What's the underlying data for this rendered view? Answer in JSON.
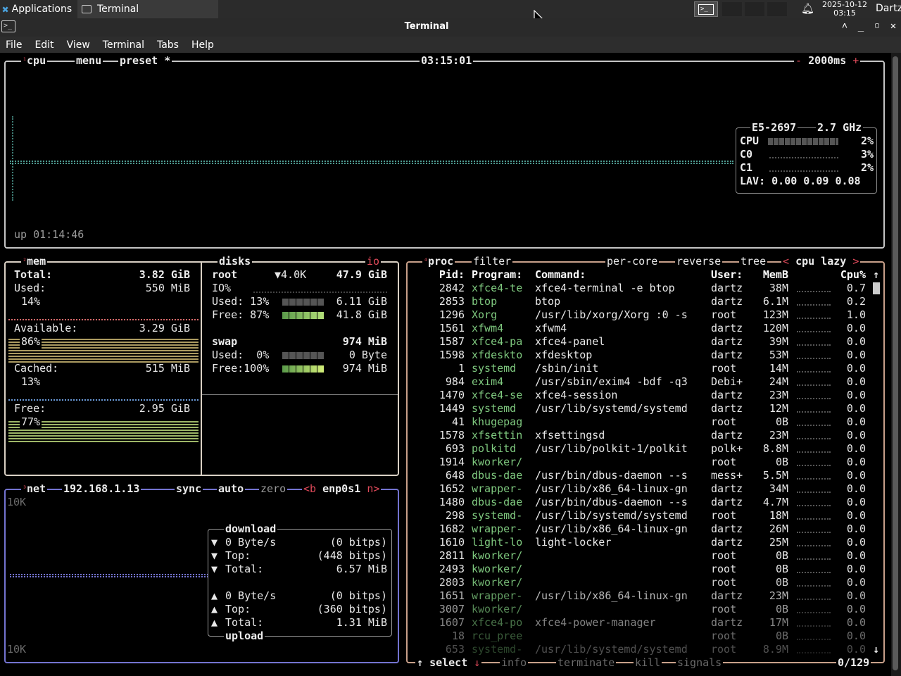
{
  "panel": {
    "apps_label": "Applications",
    "task_title": "Terminal",
    "clock_date": "2025-10-12",
    "clock_time": "03:15",
    "user": "Dartz"
  },
  "window": {
    "title": "Terminal",
    "menu": [
      "File",
      "Edit",
      "View",
      "Terminal",
      "Tabs",
      "Help"
    ]
  },
  "cpu_box": {
    "num": "¹",
    "title": "cpu",
    "menu": "menu",
    "preset": "preset *",
    "clock": "03:15:01",
    "minus": "-",
    "interval": "2000ms",
    "plus": "+",
    "uptime": "up 01:14:46",
    "model": "E5-2697",
    "freq": "2.7 GHz",
    "rows": [
      {
        "label": "CPU",
        "value": "2%"
      },
      {
        "label": "C0",
        "value": "3%"
      },
      {
        "label": "C1",
        "value": "2%"
      }
    ],
    "lav": "LAV: 0.00 0.09 0.08"
  },
  "mem_box": {
    "num": "²",
    "title": "mem",
    "total_label": "Total:",
    "total_value": "3.82 GiB",
    "used_label": "Used:",
    "used_value": "550 MiB",
    "used_pct": "14%",
    "avail_label": "Available:",
    "avail_value": "3.29 GiB",
    "avail_pct": "86%",
    "cached_label": "Cached:",
    "cached_value": "515 MiB",
    "cached_pct": "13%",
    "free_label": "Free:",
    "free_value": "2.95 GiB",
    "free_pct": "77%"
  },
  "disks_box": {
    "title": "disks",
    "io": "io",
    "root_label": "root",
    "root_io": "▼4.0K",
    "root_size": "47.9 GiB",
    "io_pct": "IO%",
    "used_label": "Used: 13%",
    "used_value": "6.11 GiB",
    "free_label": "Free: 87%",
    "free_value": "41.8 GiB",
    "swap_label": "swap",
    "swap_size": "974 MiB",
    "swap_used_label": "Used:  0%",
    "swap_used_value": "0 Byte",
    "swap_free_label": "Free:100%",
    "swap_free_value": "974 MiB"
  },
  "net_box": {
    "num": "³",
    "title": "net",
    "ip": "192.168.1.13",
    "sync": "sync",
    "auto": "auto",
    "zero": "zero",
    "iface_prev": "<b",
    "iface": "enp0s1",
    "iface_next": "n>",
    "scale_top": "10K",
    "scale_bottom": "10K",
    "download_title": "download",
    "upload_title": "upload",
    "download": [
      {
        "arrow": "▼",
        "label": "0 Byte/s",
        "value": "(0 bitps)"
      },
      {
        "arrow": "▼",
        "label": "Top:",
        "value": "(448 bitps)"
      },
      {
        "arrow": "▼",
        "label": "Total:",
        "value": "6.57 MiB"
      }
    ],
    "upload": [
      {
        "arrow": "▲",
        "label": "0 Byte/s",
        "value": "(0 bitps)"
      },
      {
        "arrow": "▲",
        "label": "Top:",
        "value": "(360 bitps)"
      },
      {
        "arrow": "▲",
        "label": "Total:",
        "value": "1.31 MiB"
      }
    ]
  },
  "proc_box": {
    "num": "⁴",
    "title": "proc",
    "filter": "filter",
    "per_core": "per-core",
    "reverse": "reverse",
    "tree": "tree",
    "sort_prev": "<",
    "sort": "cpu lazy",
    "sort_next": ">",
    "headers": {
      "pid": "Pid:",
      "program": "Program:",
      "command": "Command:",
      "user": "User:",
      "mem": "MemB",
      "cpu": "Cpu%"
    },
    "footer": {
      "select": "select",
      "info": "info",
      "terminate": "terminate",
      "kill": "kill",
      "signals": "signals",
      "count": "0/129"
    },
    "rows": [
      {
        "pid": "2842",
        "program": "xfce4-te",
        "command": "xfce4-terminal -e btop",
        "user": "dartz",
        "mem": "38M",
        "cpu": "0.7"
      },
      {
        "pid": "2853",
        "program": "btop",
        "command": "btop",
        "user": "dartz",
        "mem": "6.1M",
        "cpu": "0.2"
      },
      {
        "pid": "1296",
        "program": "Xorg",
        "command": "/usr/lib/xorg/Xorg :0 -s",
        "user": "root",
        "mem": "123M",
        "cpu": "1.0"
      },
      {
        "pid": "1561",
        "program": "xfwm4",
        "command": "xfwm4",
        "user": "dartz",
        "mem": "120M",
        "cpu": "0.0"
      },
      {
        "pid": "1587",
        "program": "xfce4-pa",
        "command": "xfce4-panel",
        "user": "dartz",
        "mem": "39M",
        "cpu": "0.0"
      },
      {
        "pid": "1598",
        "program": "xfdeskto",
        "command": "xfdesktop",
        "user": "dartz",
        "mem": "53M",
        "cpu": "0.0"
      },
      {
        "pid": "1",
        "program": "systemd",
        "command": "/sbin/init",
        "user": "root",
        "mem": "14M",
        "cpu": "0.0"
      },
      {
        "pid": "984",
        "program": "exim4",
        "command": "/usr/sbin/exim4 -bdf -q3",
        "user": "Debi+",
        "mem": "24M",
        "cpu": "0.0"
      },
      {
        "pid": "1470",
        "program": "xfce4-se",
        "command": "xfce4-session",
        "user": "dartz",
        "mem": "23M",
        "cpu": "0.0"
      },
      {
        "pid": "1449",
        "program": "systemd",
        "command": "/usr/lib/systemd/systemd",
        "user": "dartz",
        "mem": "12M",
        "cpu": "0.0"
      },
      {
        "pid": "41",
        "program": "khugepag",
        "command": "",
        "user": "root",
        "mem": "0B",
        "cpu": "0.0"
      },
      {
        "pid": "1578",
        "program": "xfsettin",
        "command": "xfsettingsd",
        "user": "dartz",
        "mem": "23M",
        "cpu": "0.0"
      },
      {
        "pid": "693",
        "program": "polkitd",
        "command": "/usr/lib/polkit-1/polkit",
        "user": "polk+",
        "mem": "8.8M",
        "cpu": "0.0"
      },
      {
        "pid": "1914",
        "program": "kworker/",
        "command": "",
        "user": "root",
        "mem": "0B",
        "cpu": "0.0"
      },
      {
        "pid": "648",
        "program": "dbus-dae",
        "command": "/usr/bin/dbus-daemon --s",
        "user": "mess+",
        "mem": "5.5M",
        "cpu": "0.0"
      },
      {
        "pid": "1652",
        "program": "wrapper-",
        "command": "/usr/lib/x86_64-linux-gn",
        "user": "dartz",
        "mem": "34M",
        "cpu": "0.0"
      },
      {
        "pid": "1480",
        "program": "dbus-dae",
        "command": "/usr/bin/dbus-daemon --s",
        "user": "dartz",
        "mem": "4.7M",
        "cpu": "0.0"
      },
      {
        "pid": "298",
        "program": "systemd-",
        "command": "/usr/lib/systemd/systemd",
        "user": "root",
        "mem": "18M",
        "cpu": "0.0"
      },
      {
        "pid": "1682",
        "program": "wrapper-",
        "command": "/usr/lib/x86_64-linux-gn",
        "user": "dartz",
        "mem": "26M",
        "cpu": "0.0"
      },
      {
        "pid": "1610",
        "program": "light-lo",
        "command": "light-locker",
        "user": "dartz",
        "mem": "25M",
        "cpu": "0.0"
      },
      {
        "pid": "2811",
        "program": "kworker/",
        "command": "",
        "user": "root",
        "mem": "0B",
        "cpu": "0.0"
      },
      {
        "pid": "2493",
        "program": "kworker/",
        "command": "",
        "user": "root",
        "mem": "0B",
        "cpu": "0.0"
      },
      {
        "pid": "2803",
        "program": "kworker/",
        "command": "",
        "user": "root",
        "mem": "0B",
        "cpu": "0.0"
      },
      {
        "pid": "1651",
        "program": "wrapper-",
        "command": "/usr/lib/x86_64-linux-gn",
        "user": "dartz",
        "mem": "23M",
        "cpu": "0.0"
      },
      {
        "pid": "3007",
        "program": "kworker/",
        "command": "",
        "user": "root",
        "mem": "0B",
        "cpu": "0.0"
      },
      {
        "pid": "1607",
        "program": "xfce4-po",
        "command": "xfce4-power-manager",
        "user": "dartz",
        "mem": "17M",
        "cpu": "0.0"
      },
      {
        "pid": "18",
        "program": "rcu_pree",
        "command": "",
        "user": "root",
        "mem": "0B",
        "cpu": "0.0"
      },
      {
        "pid": "653",
        "program": "systemd-",
        "command": "/usr/lib/systemd/systemd",
        "user": "root",
        "mem": "8.9M",
        "cpu": "0.0"
      }
    ]
  },
  "colors": {
    "cpu_box": "#c5c5c5",
    "mem_box": "#d9d0c4",
    "net_box": "#7373d0",
    "proc_box": "#c8a08a",
    "accent_red": "#e04a5a",
    "program_green": "#7fc97f"
  }
}
